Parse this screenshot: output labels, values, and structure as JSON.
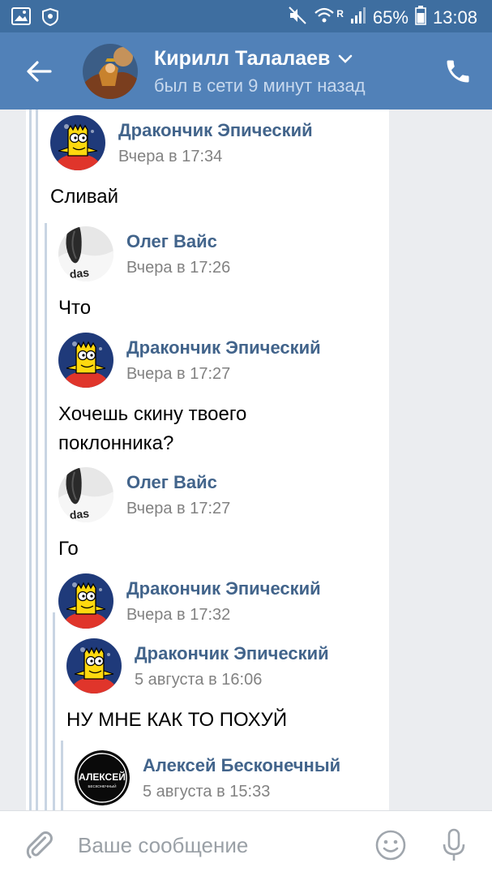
{
  "statusbar": {
    "battery": "65%",
    "time": "13:08",
    "roaming": "R",
    "icons": [
      "gallery-icon",
      "shield-icon",
      "mute-icon",
      "wifi-icon",
      "signal-icon",
      "battery-icon"
    ]
  },
  "header": {
    "name": "Кирилл Талалаев",
    "status": "был в сети 9 минут назад",
    "icons": [
      "back-arrow-icon",
      "chevron-down-icon",
      "phone-icon"
    ]
  },
  "messages": [
    {
      "author": "Дракончик Эпический",
      "time": "Вчера в 17:34",
      "text": "Сливай",
      "avatar": "bart-avatar"
    },
    {
      "author": "Олег Вайс",
      "time": "Вчера в 17:26",
      "text": "Что",
      "avatar": "oleg-avatar"
    },
    {
      "author": "Дракончик Эпический",
      "time": "Вчера в 17:27",
      "text": "Хочешь скину твоего поклонника?",
      "avatar": "bart-avatar"
    },
    {
      "author": "Олег Вайс",
      "time": "Вчера в 17:27",
      "text": "Го",
      "avatar": "oleg-avatar"
    },
    {
      "author": "Дракончик Эпический",
      "time": "Вчера в 17:32",
      "text": "",
      "avatar": "bart-avatar"
    },
    {
      "author": "Дракончик Эпический",
      "time": "5 августа в 16:06",
      "text": "НУ МНЕ КАК ТО ПОХУЙ",
      "avatar": "bart-avatar"
    },
    {
      "author": "Алексей Бесконечный",
      "time": "5 августа в 15:33",
      "text": "",
      "avatar": "aleksey-avatar",
      "avatar_text": "АЛЕКСЕЙ",
      "avatar_subtext": "БЕСКОНЕЧНЫЙ"
    }
  ],
  "input": {
    "placeholder": "Ваше сообщение",
    "icons": [
      "attach-icon",
      "emoji-icon",
      "mic-icon"
    ]
  },
  "colors": {
    "header": "#5181b8",
    "statusbar": "#3e6ea0",
    "author": "#42648b",
    "time": "#828282",
    "thread_line": "#c9d5e3"
  }
}
